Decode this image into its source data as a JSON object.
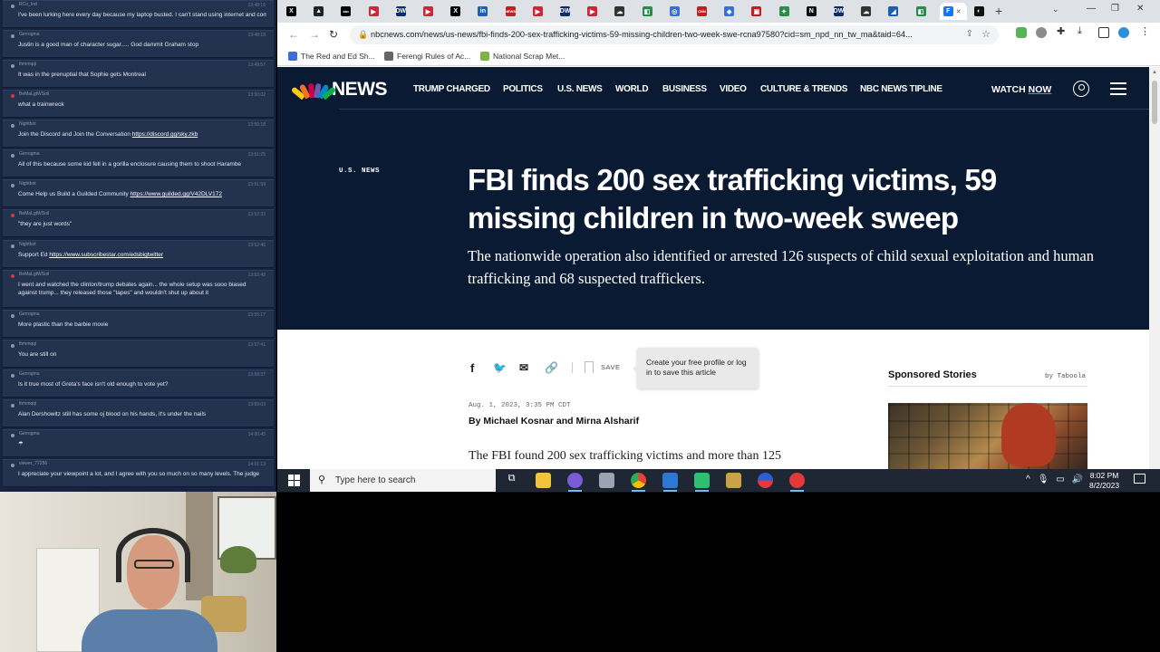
{
  "chat": {
    "messages": [
      {
        "user": "RCo_Ind",
        "time": "13:48:16",
        "text": "I've been lurking here every day because my laptop busted. I can't stand using internet and commenting on a phone. I'm a laptop guy.",
        "dot": "grey"
      },
      {
        "user": "Gerrogma",
        "time": "13:48:18",
        "text": "Justin is a good man of character sugar..... God dammit Graham stop",
        "dot": "grey"
      },
      {
        "user": "thmmqqi",
        "time": "13:49:57",
        "text": "It was in the prenuptial that Sophie gets Montreal",
        "dot": "grey"
      },
      {
        "user": "BeMaLgtWSoil",
        "time": "13:50:02",
        "text": "what a trainwreck",
        "dot": "red"
      },
      {
        "user": "Nightbot",
        "time": "13:50:18",
        "text": "Join the Discord and Join the Conversation ",
        "link": "https://discord.gg/sky.zkb",
        "dot": "grey"
      },
      {
        "user": "Gerrogma",
        "time": "13:51:25",
        "text": "All of this because some kid fell in a gorilla enclosure causing them to shoot Harambe",
        "dot": "grey"
      },
      {
        "user": "Nightbot",
        "time": "13:51:59",
        "text": "Come Help us Build a Guilded Community ",
        "link": "https://www.guilded.gg/V42DLV172",
        "dot": "grey"
      },
      {
        "user": "BeMaLgtWSoil",
        "time": "13:52:33",
        "text": "\"they are just words\"",
        "dot": "red"
      },
      {
        "user": "Nightbot",
        "time": "13:52:46",
        "text": "Support Ed ",
        "link": "https://www.subscribestar.com/edsbigtwitter",
        "dot": "grey"
      },
      {
        "user": "BeMaLgtWSoil",
        "time": "13:53:48",
        "text": "I went and watched the clinton/trump debates again... the whole setup was sooo biased against trump... they released those \"tapes\" and wouldn't shut up about it",
        "dot": "red",
        "wrap": true
      },
      {
        "user": "Gerrogma",
        "time": "13:55:17",
        "text": "More plastic than the barbie movie",
        "dot": "grey"
      },
      {
        "user": "thmmqqi",
        "time": "13:57:41",
        "text": "You are still on",
        "dot": "grey"
      },
      {
        "user": "Gerrogma",
        "time": "13:58:37",
        "text": "Is it true most of Greta's face isn't old enough to vote yet?",
        "dot": "grey"
      },
      {
        "user": "thmmqqi",
        "time": "13:59:03",
        "text": "Alan Dershowitz still has some oj blood on his hands, it's under the nails",
        "dot": "grey"
      },
      {
        "user": "Gerrogma",
        "time": "14:00:45",
        "text": "☂",
        "dot": "grey"
      },
      {
        "user": "viewer_77256",
        "time": "14:01:13",
        "text": "I appreciate your viewpoint a lot, and I agree with you so much on so many levels. The judge",
        "dot": "grey"
      }
    ]
  },
  "browser": {
    "tabs": [
      {
        "icon": "X",
        "color": "#000000"
      },
      {
        "icon": "▲",
        "color": "#222222"
      },
      {
        "icon": "abc",
        "color": "#000000"
      },
      {
        "icon": "▶",
        "color": "#d0253a"
      },
      {
        "icon": "DW",
        "color": "#0d2c6b"
      },
      {
        "icon": "▶",
        "color": "#d0253a"
      },
      {
        "icon": "X",
        "color": "#000000"
      },
      {
        "icon": "in",
        "color": "#1a5fb4"
      },
      {
        "icon": "NEWS",
        "color": "#c61d23"
      },
      {
        "icon": "▶",
        "color": "#d0253a"
      },
      {
        "icon": "DW",
        "color": "#0d2c6b"
      },
      {
        "icon": "▶",
        "color": "#d0253a"
      },
      {
        "icon": "☁",
        "color": "#333333"
      },
      {
        "icon": "◧",
        "color": "#2a8c4a"
      },
      {
        "icon": "◎",
        "color": "#3a6fd8"
      },
      {
        "icon": "CNN",
        "color": "#c61d23"
      },
      {
        "icon": "◆",
        "color": "#3a6fd8"
      },
      {
        "icon": "▣",
        "color": "#c61d23"
      },
      {
        "icon": "✦",
        "color": "#2a8c4a"
      },
      {
        "icon": "N",
        "color": "#111111"
      },
      {
        "icon": "DW",
        "color": "#0d2c6b"
      },
      {
        "icon": "☁",
        "color": "#333333"
      },
      {
        "icon": "◢",
        "color": "#1a5fb4"
      },
      {
        "icon": "◧",
        "color": "#2a8c4a"
      },
      {
        "icon": "F",
        "color": "#1877f2",
        "active": true
      },
      {
        "icon": "◐",
        "color": "#111111"
      }
    ],
    "url": "nbcnews.com/news/us-news/fbi-finds-200-sex-trafficking-victims-59-missing-children-two-week-swe-rcna97580?cid=sm_npd_nn_tw_ma&taid=64...",
    "bookmarks": [
      {
        "label": "The Red and Ed Sh...",
        "color": "#3a6fd8"
      },
      {
        "label": "Ferengi Rules of Ac...",
        "color": "#666666"
      },
      {
        "label": "National Scrap Met...",
        "color": "#7cb342"
      }
    ]
  },
  "nbc": {
    "logo_text": "NEWS",
    "nav": [
      "TRUMP CHARGED",
      "POLITICS",
      "U.S. NEWS",
      "WORLD",
      "BUSINESS",
      "VIDEO",
      "CULTURE & TRENDS",
      "NBC NEWS TIPLINE"
    ],
    "watch": "WATCH",
    "now": "NOW",
    "section": "U.S. NEWS",
    "headline": "FBI finds 200 sex trafficking victims, 59 missing children in two-week sweep",
    "dek": "The nationwide operation also identified or arrested 126 suspects of child sexual exploitation and human trafficking and 68 suspected traffickers.",
    "save": "SAVE",
    "tooltip": "Create your free profile or log in to save this article",
    "date": "Aug. 1, 2023, 3:35 PM CDT",
    "byline": "By Michael Kosnar and Mirna Alsharif",
    "body_start": "The FBI found 200 sex trafficking victims and more than 125",
    "sponsored": "Sponsored Stories",
    "taboola": "by Taboola"
  },
  "taskbar": {
    "search_placeholder": "Type here to search",
    "time": "8:02 PM",
    "date": "8/2/2023"
  }
}
